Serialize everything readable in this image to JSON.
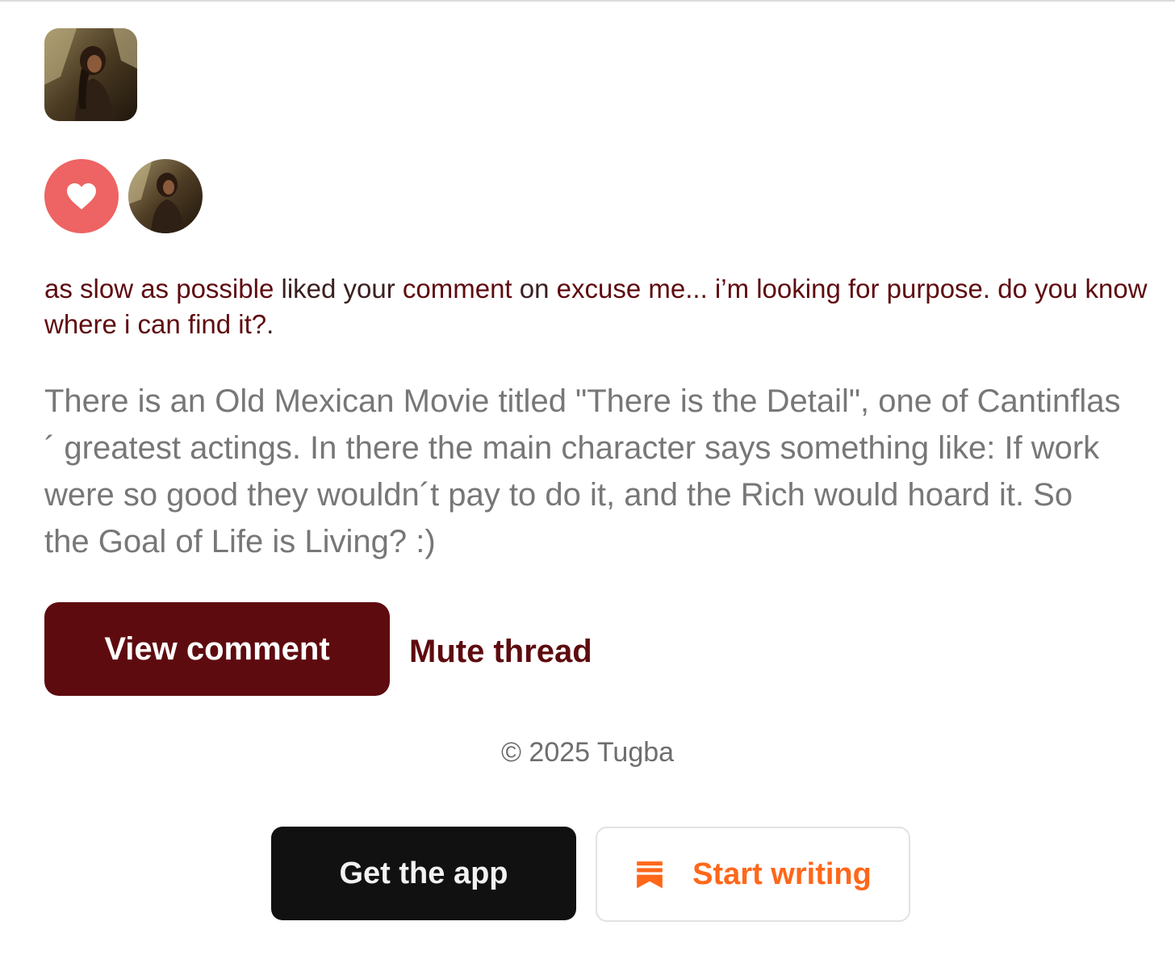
{
  "colors": {
    "brand_dark_red": "#5e0b0f",
    "heart_red": "#ee6363",
    "orange": "#ff6719",
    "black_button": "#111111"
  },
  "publication": {
    "logo_icon": "publication-logo-photo"
  },
  "activity": {
    "reaction_icon": "heart-icon",
    "liker_avatar_icon": "user-avatar-photo"
  },
  "notification": {
    "actor": "as slow as possible",
    "action_1": " liked your ",
    "object": "comment",
    "action_2": " on ",
    "post_title": "excuse me... i’m looking for purpose. do you know where i can find it?",
    "suffix": "."
  },
  "comment": {
    "text": "There is an Old Mexican Movie titled \"There is the Detail\", one of Cantinflas´ greatest actings. In there the main character says something like: If work were so good they wouldn´t pay to do it, and the Rich would hoard it. So the Goal of Life is Living? :)"
  },
  "actions": {
    "view_comment": "View comment",
    "mute_thread": "Mute thread"
  },
  "footer": {
    "copyright": "© 2025 Tugba",
    "get_app": "Get the app",
    "start_writing": "Start writing",
    "start_writing_icon": "bookmark-stack-icon"
  }
}
